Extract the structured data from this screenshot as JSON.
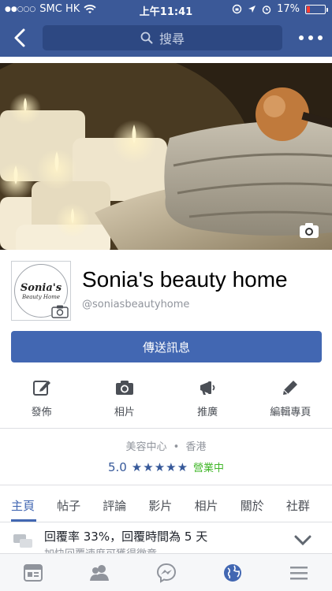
{
  "status_bar": {
    "signal": "●●○○○",
    "carrier": "SMC HK",
    "time": "上午11:41",
    "battery_percent": "17%",
    "battery_level": 0.17
  },
  "nav": {
    "search_placeholder": "搜尋"
  },
  "page": {
    "name": "Sonia's beauty home",
    "handle": "@soniasbeautyhome",
    "avatar_title": "Sonia's",
    "avatar_subtitle": "Beauty Home",
    "message_button": "傳送訊息"
  },
  "actions": [
    {
      "label": "發佈",
      "icon": "compose-icon"
    },
    {
      "label": "相片",
      "icon": "camera-icon"
    },
    {
      "label": "推廣",
      "icon": "megaphone-icon"
    },
    {
      "label": "編輯專頁",
      "icon": "pencil-icon"
    }
  ],
  "info": {
    "category": "美容中心",
    "separator": "•",
    "location": "香港",
    "rating": "5.0",
    "stars": "★★★★★",
    "open_status": "營業中"
  },
  "tabs": [
    {
      "label": "主頁",
      "active": true
    },
    {
      "label": "帖子"
    },
    {
      "label": "評論"
    },
    {
      "label": "影片"
    },
    {
      "label": "相片"
    },
    {
      "label": "關於"
    },
    {
      "label": "社群"
    }
  ],
  "response": {
    "main": "回覆率 33%，回覆時間為 5 天",
    "sub": "加快回覆速度可獲得徽章"
  },
  "bottom_nav": [
    "news-feed-icon",
    "friends-icon",
    "messenger-icon",
    "globe-icon",
    "menu-icon"
  ],
  "colors": {
    "brand": "#3b5998",
    "button": "#4267b2",
    "open_green": "#42b72a",
    "battery_red": "#ff3b30"
  }
}
